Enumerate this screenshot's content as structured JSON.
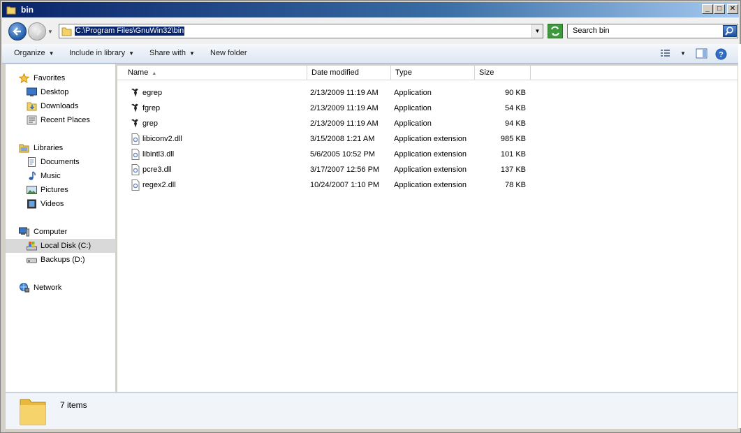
{
  "window": {
    "title": "bin",
    "controls": {
      "minimize": "_",
      "maximize": "□",
      "close": "✕"
    }
  },
  "nav": {
    "address": "C:\\Program Files\\GnuWin32\\bin",
    "search_placeholder": "Search bin"
  },
  "toolbar": {
    "organize": "Organize",
    "include_in_library": "Include in library",
    "share_with": "Share with",
    "new_folder": "New folder"
  },
  "sidebar": {
    "favorites": {
      "label": "Favorites",
      "items": [
        {
          "label": "Desktop",
          "icon": "desktop-icon"
        },
        {
          "label": "Downloads",
          "icon": "downloads-folder-icon"
        },
        {
          "label": "Recent Places",
          "icon": "recent-places-icon"
        }
      ]
    },
    "libraries": {
      "label": "Libraries",
      "items": [
        {
          "label": "Documents",
          "icon": "documents-icon"
        },
        {
          "label": "Music",
          "icon": "music-icon"
        },
        {
          "label": "Pictures",
          "icon": "pictures-icon"
        },
        {
          "label": "Videos",
          "icon": "videos-icon"
        }
      ]
    },
    "computer": {
      "label": "Computer",
      "items": [
        {
          "label": "Local Disk (C:)",
          "icon": "local-disk-icon",
          "selected": true
        },
        {
          "label": "Backups (D:)",
          "icon": "drive-icon"
        }
      ]
    },
    "network": {
      "label": "Network"
    }
  },
  "columns": {
    "name": "Name",
    "date_modified": "Date modified",
    "type": "Type",
    "size": "Size"
  },
  "files": [
    {
      "name": "egrep",
      "date": "2/13/2009 11:19 AM",
      "type": "Application",
      "size": "90 KB",
      "icon": "gnu-app-icon"
    },
    {
      "name": "fgrep",
      "date": "2/13/2009 11:19 AM",
      "type": "Application",
      "size": "54 KB",
      "icon": "gnu-app-icon"
    },
    {
      "name": "grep",
      "date": "2/13/2009 11:19 AM",
      "type": "Application",
      "size": "94 KB",
      "icon": "gnu-app-icon"
    },
    {
      "name": "libiconv2.dll",
      "date": "3/15/2008 1:21 AM",
      "type": "Application extension",
      "size": "985 KB",
      "icon": "dll-file-icon"
    },
    {
      "name": "libintl3.dll",
      "date": "5/6/2005 10:52 PM",
      "type": "Application extension",
      "size": "101 KB",
      "icon": "dll-file-icon"
    },
    {
      "name": "pcre3.dll",
      "date": "3/17/2007 12:56 PM",
      "type": "Application extension",
      "size": "137 KB",
      "icon": "dll-file-icon"
    },
    {
      "name": "regex2.dll",
      "date": "10/24/2007 1:10 PM",
      "type": "Application extension",
      "size": "78 KB",
      "icon": "dll-file-icon"
    }
  ],
  "details": {
    "item_count": "7 items"
  },
  "colors": {
    "title_bar": "#0a246a",
    "selection": "#d9d9d9",
    "command_bar": "#dde6f2"
  }
}
